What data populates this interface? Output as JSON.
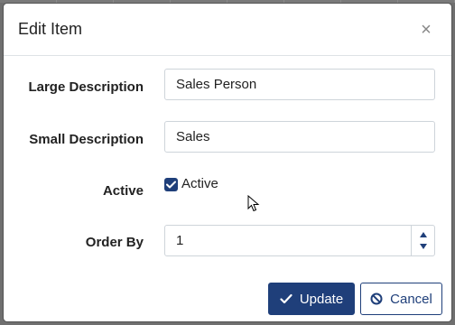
{
  "modal": {
    "title": "Edit Item",
    "close_icon": "×"
  },
  "form": {
    "large_description": {
      "label": "Large Description",
      "value": "Sales Person"
    },
    "small_description": {
      "label": "Small Description",
      "value": "Sales"
    },
    "active": {
      "label": "Active",
      "checkbox_label": "Active",
      "checked": true
    },
    "order_by": {
      "label": "Order By",
      "value": "1"
    }
  },
  "buttons": {
    "update_label": "Update",
    "cancel_label": "Cancel"
  },
  "colors": {
    "primary": "#1f3f7a",
    "border": "#ced4da",
    "backdrop": "#6f6f6f"
  },
  "icons": {
    "close": "close-icon",
    "check": "check-icon",
    "cancel": "ban-icon",
    "spin_up": "caret-up-icon",
    "spin_down": "caret-down-icon",
    "cursor": "mouse-pointer-icon"
  }
}
